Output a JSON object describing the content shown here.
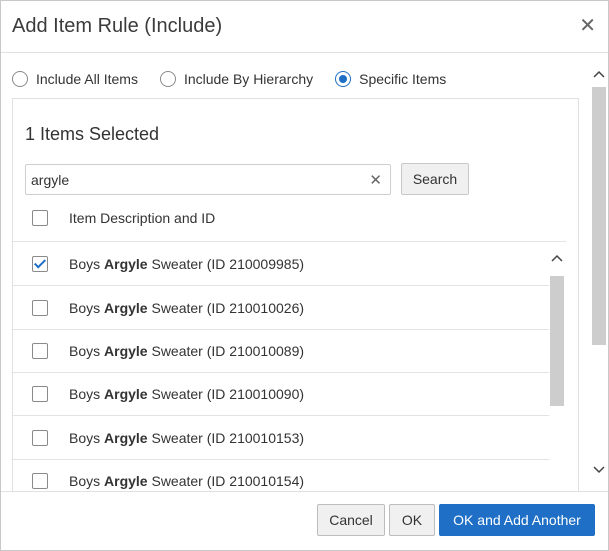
{
  "dialog": {
    "title": "Add Item Rule (Include)",
    "close_icon": "close-icon"
  },
  "radios": [
    {
      "label": "Include All Items",
      "checked": false
    },
    {
      "label": "Include By Hierarchy",
      "checked": false
    },
    {
      "label": "Specific Items",
      "checked": true
    }
  ],
  "selection": {
    "count_label": "1 Items Selected"
  },
  "search": {
    "value": "argyle",
    "button_label": "Search",
    "clear_icon": "clear-icon"
  },
  "table": {
    "column_header": "Item Description and ID",
    "rows": [
      {
        "prefix": "Boys ",
        "highlight": "Argyle",
        "suffix": " Sweater (ID 210009985)",
        "checked": true
      },
      {
        "prefix": "Boys ",
        "highlight": "Argyle",
        "suffix": " Sweater (ID 210010026)",
        "checked": false
      },
      {
        "prefix": "Boys ",
        "highlight": "Argyle",
        "suffix": " Sweater (ID 210010089)",
        "checked": false
      },
      {
        "prefix": "Boys ",
        "highlight": "Argyle",
        "suffix": " Sweater (ID 210010090)",
        "checked": false
      },
      {
        "prefix": "Boys ",
        "highlight": "Argyle",
        "suffix": " Sweater (ID 210010153)",
        "checked": false
      },
      {
        "prefix": "Boys ",
        "highlight": "Argyle",
        "suffix": " Sweater (ID 210010154)",
        "checked": false
      }
    ]
  },
  "footer": {
    "cancel_label": "Cancel",
    "ok_label": "OK",
    "ok_add_another_label": "OK and Add Another"
  },
  "colors": {
    "accent": "#1e6fc5",
    "border": "#e3e3e3",
    "scroll_thumb": "#cdcdcd"
  }
}
